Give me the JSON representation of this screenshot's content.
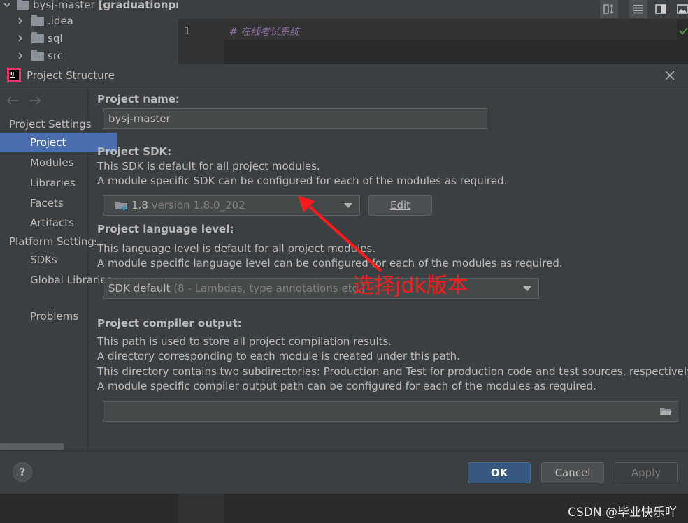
{
  "ide": {
    "project_root": "bysj-master",
    "project_root_module": "[graduationproj",
    "tree": [
      ".idea",
      "sql",
      "src"
    ],
    "line_number": "1",
    "code_line": "#  在线考试系统"
  },
  "dialog": {
    "title": "Project Structure",
    "sidebar": {
      "section_project_settings": "Project Settings",
      "items_project": [
        "Project",
        "Modules",
        "Libraries",
        "Facets",
        "Artifacts"
      ],
      "section_platform_settings": "Platform Settings",
      "items_platform": [
        "SDKs",
        "Global Libraries"
      ],
      "problems": "Problems"
    },
    "project_name": {
      "label": "Project name:",
      "value": "bysj-master"
    },
    "project_sdk": {
      "label": "Project SDK:",
      "desc1": "This SDK is default for all project modules.",
      "desc2": "A module specific SDK can be configured for each of the modules as required.",
      "selected_name": "1.8",
      "selected_version": "version 1.8.0_202",
      "edit_button": "Edit"
    },
    "language_level": {
      "label": "Project language level:",
      "desc1": "This language level is default for all project modules.",
      "desc2": "A module specific language level can be configured for each of the modules as required.",
      "selected_name": "SDK default",
      "selected_detail": "(8 - Lambdas, type annotations etc.)"
    },
    "annotation": "选择jdk版本",
    "compiler_output": {
      "label": "Project compiler output:",
      "desc1": "This path is used to store all project compilation results.",
      "desc2": "A directory corresponding to each module is created under this path.",
      "desc3": "This directory contains two subdirectories: Production and Test for production code and test sources, respectively.",
      "desc4": "A module specific compiler output path can be configured for each of the modules as required.",
      "value": ""
    },
    "buttons": {
      "help": "?",
      "ok": "OK",
      "cancel": "Cancel",
      "apply": "Apply"
    }
  },
  "watermark": "CSDN @毕业快乐吖",
  "colors": {
    "selection": "#4b6eaf",
    "annotation_red": "#ff1a1a",
    "ok_button": "#365880"
  }
}
